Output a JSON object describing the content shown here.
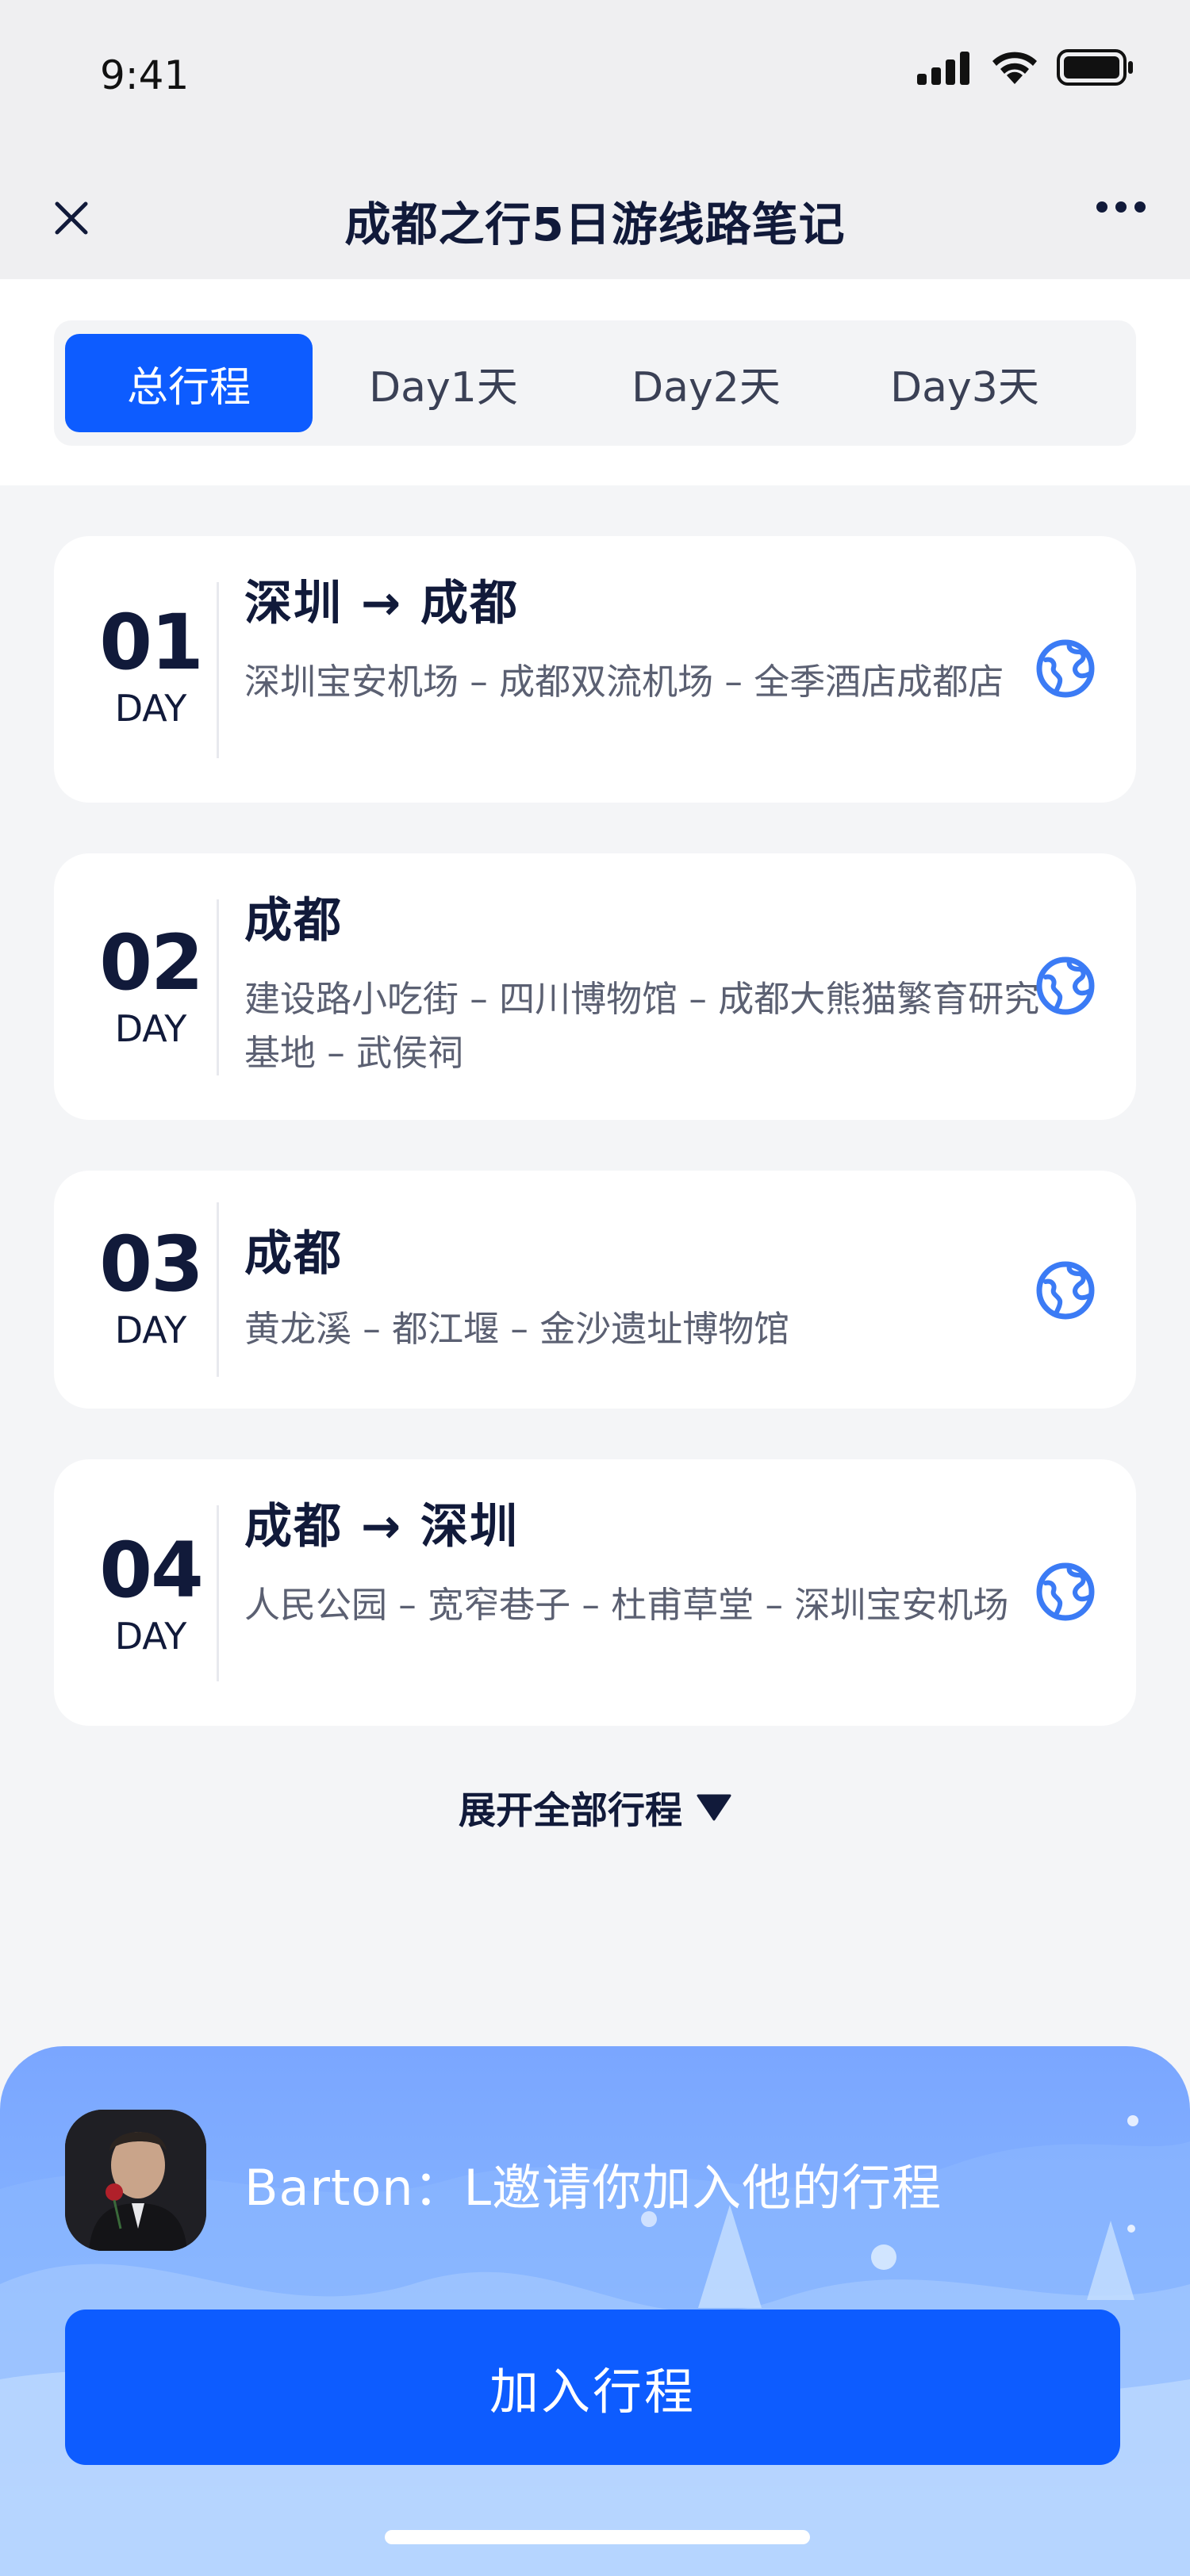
{
  "status_bar": {
    "time": "9:41"
  },
  "nav": {
    "title": "成都之行5日游线路笔记"
  },
  "tabs": [
    {
      "label": "总行程",
      "active": true
    },
    {
      "label": "Day1天",
      "active": false
    },
    {
      "label": "Day2天",
      "active": false
    },
    {
      "label": "Day3天",
      "active": false
    }
  ],
  "days": [
    {
      "num": "01",
      "unit": "DAY",
      "route": "深圳 → 成都",
      "desc": "深圳宝安机场 – 成都双流机场 – 全季酒店成都店"
    },
    {
      "num": "02",
      "unit": "DAY",
      "route": "成都",
      "desc": "建设路小吃街 – 四川博物馆 – 成都大熊猫繁育研究基地 – 武侯祠"
    },
    {
      "num": "03",
      "unit": "DAY",
      "route": "成都",
      "desc": "黄龙溪 – 都江堰 – 金沙遗址博物馆"
    },
    {
      "num": "04",
      "unit": "DAY",
      "route": "成都 → 深圳",
      "desc": "人民公园 – 宽窄巷子 – 杜甫草堂 – 深圳宝安机场"
    }
  ],
  "expand_label": "展开全部行程",
  "invite": {
    "text": "Barton：L邀请你加入他的行程",
    "button_label": "加入行程"
  },
  "colors": {
    "accent": "#0d5cff",
    "icon_blue": "#3b7bf5",
    "text_dark": "#111a3a"
  }
}
